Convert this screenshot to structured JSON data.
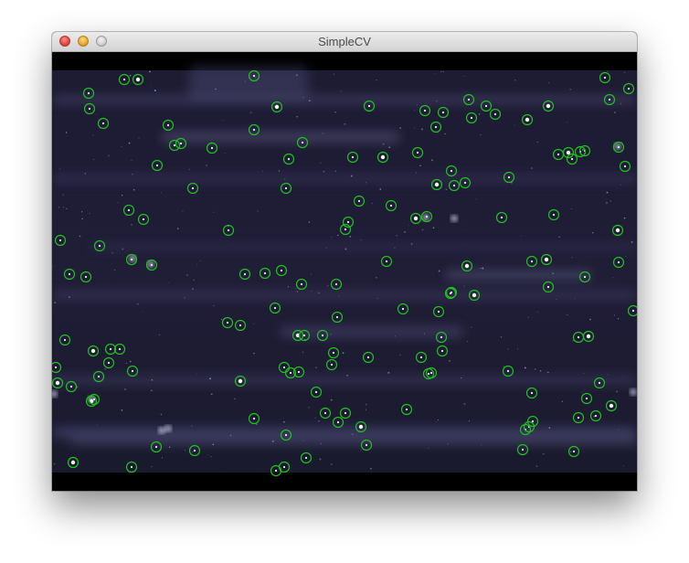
{
  "window": {
    "title": "SimpleCV"
  },
  "colors": {
    "close": "#e0443e",
    "minimize": "#e9a52a",
    "zoom": "#cfcfcf",
    "marker": "#1fc21f",
    "image_bg": "#1a1a2e"
  },
  "image": {
    "description_tag": "star-field-with-detected-blobs"
  }
}
